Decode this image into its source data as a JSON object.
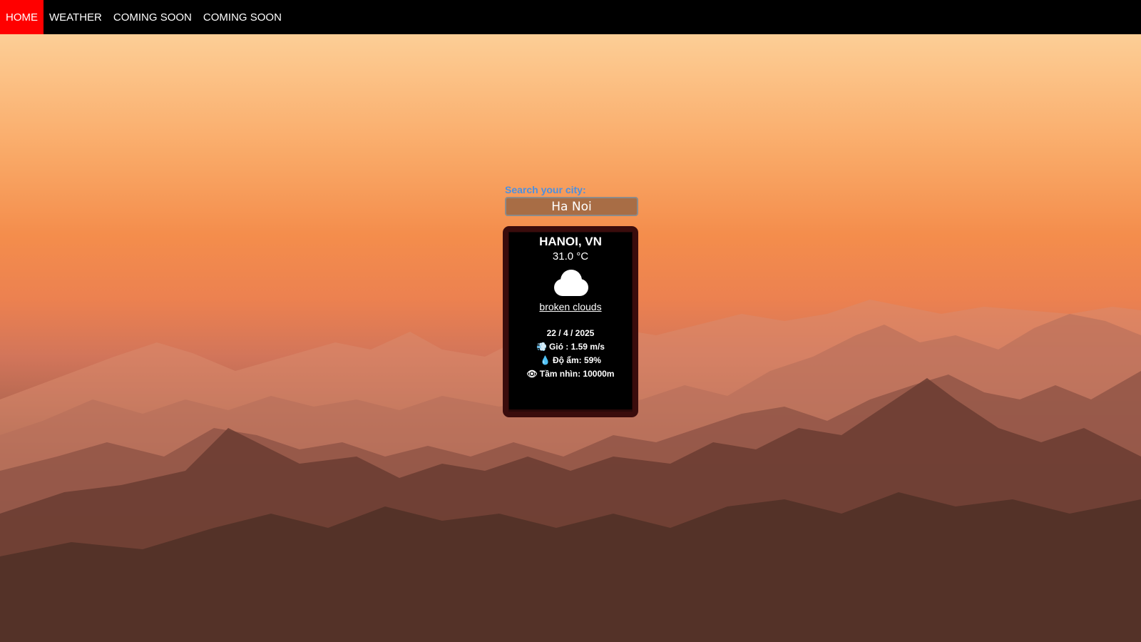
{
  "nav": {
    "items": [
      {
        "label": "HOME",
        "active": true
      },
      {
        "label": "WEATHER",
        "active": false
      },
      {
        "label": "COMING SOON",
        "active": false
      },
      {
        "label": "COMING SOON",
        "active": false
      }
    ]
  },
  "search": {
    "label": "Search your city:",
    "value": "Ha Noi"
  },
  "weather": {
    "city": "HANOI, VN",
    "temperature": "31.0 °C",
    "icon": "cloud-icon",
    "description": "broken clouds",
    "date": "22 / 4 / 2025",
    "wind": "Gió : 1.59 m/s",
    "humidity": "Độ ẩm: 59%",
    "visibility": "Tầm nhìn: 10000m"
  },
  "colors": {
    "nav_bg": "#000000",
    "nav_active": "#ff0000",
    "search_label": "#4a90e2",
    "card_bg": "#000000",
    "card_border": "#3a0c0c"
  }
}
